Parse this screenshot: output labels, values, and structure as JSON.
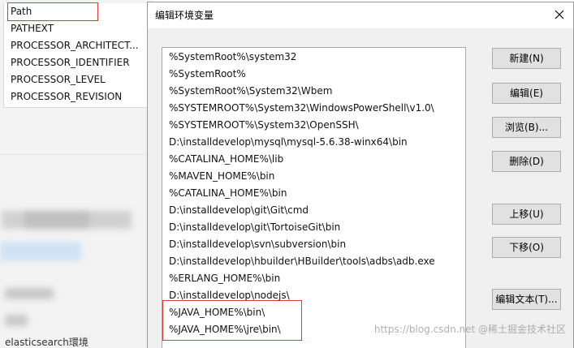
{
  "background_window": {
    "variable_names": [
      "Path",
      "PATHEXT",
      "PROCESSOR_ARCHITECT...",
      "PROCESSOR_IDENTIFIER",
      "PROCESSOR_LEVEL",
      "PROCESSOR_REVISION"
    ],
    "selected_variable": "Path",
    "bottom_text": "elasticsearch環境"
  },
  "dialog": {
    "title": "编辑环境变量",
    "paths": [
      "%SystemRoot%\\system32",
      "%SystemRoot%",
      "%SystemRoot%\\System32\\Wbem",
      "%SYSTEMROOT%\\System32\\WindowsPowerShell\\v1.0\\",
      "%SYSTEMROOT%\\System32\\OpenSSH\\",
      "D:\\installdevelop\\mysql\\mysql-5.6.38-winx64\\bin",
      "%CATALINA_HOME%\\lib",
      "%MAVEN_HOME%\\bin",
      "%CATALINA_HOME%\\bin",
      "D:\\installdevelop\\git\\Git\\cmd",
      "D:\\installdevelop\\git\\TortoiseGit\\bin",
      "D:\\installdevelop\\svn\\subversion\\bin",
      "D:\\installdevelop\\hbuilder\\HBuilder\\tools\\adbs\\adb.exe",
      "%ERLANG_HOME%\\bin",
      "D:\\installdevelop\\nodejs\\",
      "%JAVA_HOME%\\bin\\",
      "%JAVA_HOME%\\jre\\bin\\"
    ],
    "buttons": {
      "new": "新建(N)",
      "edit": "编辑(E)",
      "browse": "浏览(B)...",
      "delete": "删除(D)",
      "move_up": "上移(U)",
      "move_down": "下移(O)",
      "edit_text": "编辑文本(T)..."
    }
  },
  "watermark": "https://blog.csdn.net @稀土掘金技术社区",
  "colors": {
    "highlight": "#e0393a",
    "dialog_bg": "#f0f0f0",
    "button_bg": "#e1e1e1"
  },
  "icons": {
    "close": "close-icon"
  }
}
